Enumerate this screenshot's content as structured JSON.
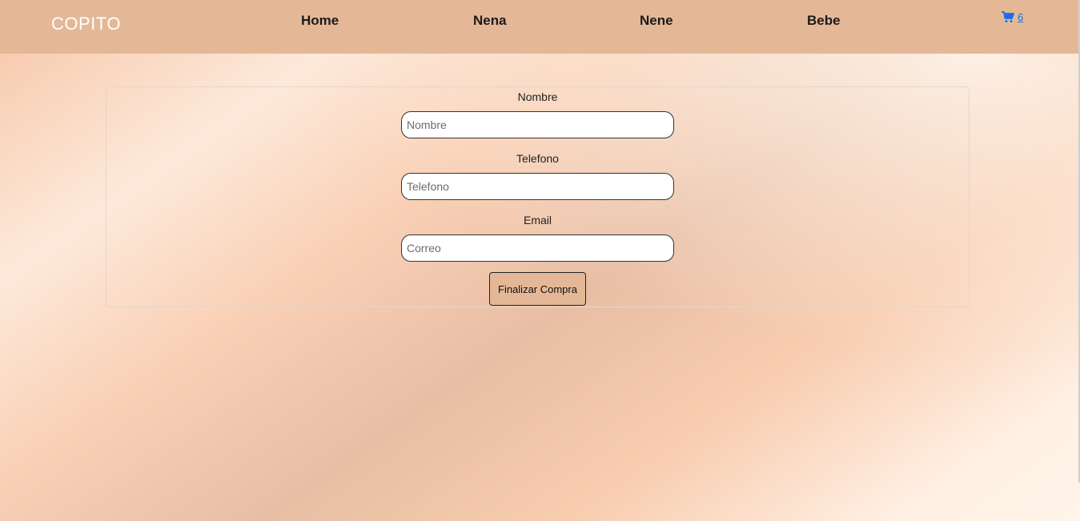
{
  "navbar": {
    "brand": "COPITO",
    "links": [
      "Home",
      "Nena",
      "Nene",
      "Bebe"
    ],
    "cart": {
      "icon": "shopping-cart-icon",
      "count": "6",
      "color": "#1a6ce8"
    },
    "background": "#e4b896"
  },
  "form": {
    "fields": [
      {
        "label": "Nombre",
        "placeholder": "Nombre"
      },
      {
        "label": "Telefono",
        "placeholder": "Telefono"
      },
      {
        "label": "Email",
        "placeholder": "Correo"
      }
    ],
    "submit_label": "Finalizar Compra",
    "submit_color": "#e4b896"
  }
}
